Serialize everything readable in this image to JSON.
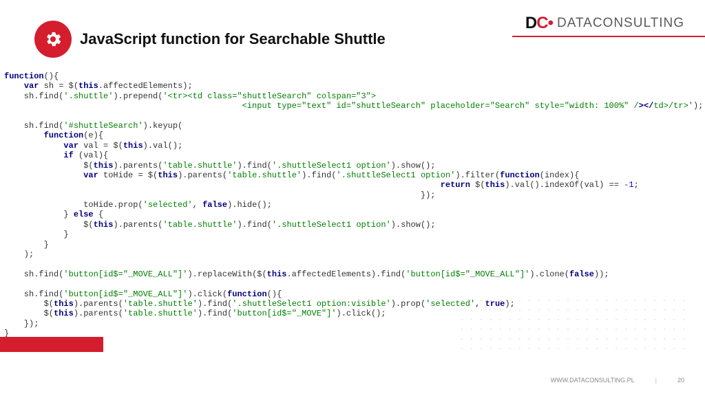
{
  "header": {
    "title": "JavaScript function for Searchable Shuttle"
  },
  "logo": {
    "mark_main": "D",
    "mark_red": "C",
    "mark_dot": "•",
    "text": "DATACONSULTING"
  },
  "code": {
    "l01a": "function",
    "l01b": "(){",
    "l02a": "    ",
    "l02b": "var",
    "l02c": " sh = $(",
    "l02d": "this",
    "l02e": ".affectedElements);",
    "l03a": "    sh.find(",
    "l03b": "'.shuttle'",
    "l03c": ").prepend(",
    "l03d": "'<tr><td class=\"shuttleSearch\" colspan=\"3\">",
    "l04a": "                                                <input type=\"text\" id=\"shuttleSearch\" placeholder=\"Search\" style=\"width: 100%\" /",
    "l04b": "></",
    "l04c": "td>",
    "l04d": "/tr>'",
    "l04e": ");",
    "l05": " ",
    "l06a": "    sh.find(",
    "l06b": "'#shuttleSearch'",
    "l06c": ").keyup(",
    "l07a": "        ",
    "l07b": "function",
    "l07c": "(e){",
    "l08a": "            ",
    "l08b": "var",
    "l08c": " val = $(",
    "l08d": "this",
    "l08e": ").val();",
    "l09a": "            ",
    "l09b": "if",
    "l09c": " (val){",
    "l10a": "                $(",
    "l10b": "this",
    "l10c": ").parents(",
    "l10d": "'table.shuttle'",
    "l10e": ").find(",
    "l10f": "'.shuttleSelect1 option'",
    "l10g": ").show();",
    "l11a": "                ",
    "l11b": "var",
    "l11c": " toHide = $(",
    "l11d": "this",
    "l11e": ").parents(",
    "l11f": "'table.shuttle'",
    "l11g": ").find(",
    "l11h": "'.shuttleSelect1 option'",
    "l11i": ").filter(",
    "l11j": "function",
    "l11k": "(index){",
    "l12a": "                                                                                        ",
    "l12b": "return",
    "l12c": " $(",
    "l12d": "this",
    "l12e": ").val().indexOf(val) == -",
    "l12f": "1",
    "l12g": ";",
    "l13a": "                                                                                    });",
    "l14a": "                toHide.prop(",
    "l14b": "'selected'",
    "l14c": ", ",
    "l14d": "false",
    "l14e": ").hide();",
    "l15a": "            } ",
    "l15b": "else",
    "l15c": " {",
    "l16a": "                $(",
    "l16b": "this",
    "l16c": ").parents(",
    "l16d": "'table.shuttle'",
    "l16e": ").find(",
    "l16f": "'.shuttleSelect1 option'",
    "l16g": ").show();",
    "l17": "            }",
    "l18": "        }",
    "l19": "    );",
    "l20": " ",
    "l21a": "    sh.find(",
    "l21b": "'button[id$=\"_MOVE_ALL\"]'",
    "l21c": ").replaceWith($(",
    "l21d": "this",
    "l21e": ".affectedElements).find(",
    "l21f": "'button[id$=\"_MOVE_ALL\"]'",
    "l21g": ").clone(",
    "l21h": "false",
    "l21i": "));",
    "l22": " ",
    "l23a": "    sh.find(",
    "l23b": "'button[id$=\"_MOVE_ALL\"]'",
    "l23c": ").click(",
    "l23d": "function",
    "l23e": "(){",
    "l24a": "        $(",
    "l24b": "this",
    "l24c": ").parents(",
    "l24d": "'table.shuttle'",
    "l24e": ").find(",
    "l24f": "'.shuttleSelect1 option:visible'",
    "l24g": ").prop(",
    "l24h": "'selected'",
    "l24i": ", ",
    "l24j": "true",
    "l24k": ");",
    "l25a": "        $(",
    "l25b": "this",
    "l25c": ").parents(",
    "l25d": "'table.shuttle'",
    "l25e": ").find(",
    "l25f": "'button[id$=\"_MOVE\"]'",
    "l25g": ").click();",
    "l26": "    });",
    "l27": "}"
  },
  "footer": {
    "url": "WWW.DATACONSULTING.PL",
    "page": "20"
  }
}
